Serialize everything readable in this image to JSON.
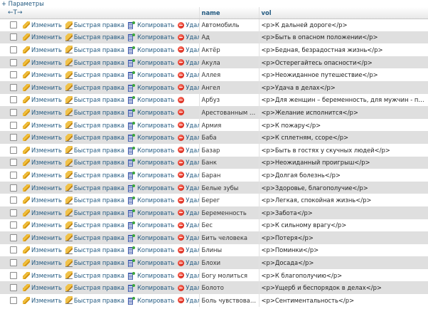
{
  "options_link": "+ Параметры",
  "header": {
    "arrows": "←T→",
    "col_name": "name",
    "col_vol": "vol"
  },
  "actions": {
    "edit": "Изменить",
    "quick_edit": "Быстрая правка",
    "copy": "Копировать",
    "delete": "Удалить"
  },
  "rows": [
    {
      "name": "Автомобиль",
      "vol": "<p>К дальней дороге</p>",
      "delete_label": "Удалить"
    },
    {
      "name": "Ад",
      "vol": "<p>Быть в опасном положении</p>",
      "delete_label": "Удалить"
    },
    {
      "name": "Актёр",
      "vol": "<p>Бедная, безрадостная жизнь</p>",
      "delete_label": "Удалить"
    },
    {
      "name": "Акула",
      "vol": "<p>Остерегайтесь опасности</p>",
      "delete_label": "Удалить"
    },
    {
      "name": "Аллея",
      "vol": "<p>Неожиданное путешествие</p>",
      "delete_label": "Удалить"
    },
    {
      "name": "Ангел",
      "vol": "<p>Удача в делах</p>",
      "delete_label": "Удалить"
    },
    {
      "name": "Арбуз",
      "vol": "<p>Для женщин – беременность, для мужчин - печаль,...",
      "delete_label": ""
    },
    {
      "name": "Арестованным быть",
      "vol": "<p>Желание исполнится</p>",
      "delete_label": ""
    },
    {
      "name": "Армия",
      "vol": "<p>К пожару</p>",
      "delete_label": "Удалить"
    },
    {
      "name": "Баба",
      "vol": "<p>К сплетням, ссоре</p>",
      "delete_label": "Удалить"
    },
    {
      "name": "Базар",
      "vol": "<p>Быть в гостях у скучных людей</p>",
      "delete_label": "Удалить"
    },
    {
      "name": "Банк",
      "vol": "<p>Неожиданный проигрыш</p>",
      "delete_label": "Удалить"
    },
    {
      "name": "Баран",
      "vol": "<p>Долгая болезнь</p>",
      "delete_label": "Удалить"
    },
    {
      "name": "Белые зубы",
      "vol": "<p>Здоровье, благополучие</p>",
      "delete_label": "Удалить"
    },
    {
      "name": "Берег",
      "vol": "<p>Легкая, спокойная жизнь</p>",
      "delete_label": "Удалить"
    },
    {
      "name": "Беременность",
      "vol": "<p>Забота</p>",
      "delete_label": "Удалить"
    },
    {
      "name": "Бес",
      "vol": "<p>К сильному врагу</p>",
      "delete_label": "Удалить"
    },
    {
      "name": "Бить человека",
      "vol": "<p>Потеря</p>",
      "delete_label": "Удалить"
    },
    {
      "name": "Блины",
      "vol": "<p>Поминки</p>",
      "delete_label": "Удалить"
    },
    {
      "name": "Блохи",
      "vol": "<p>Досада</p>",
      "delete_label": "Удалить"
    },
    {
      "name": "Богу молиться",
      "vol": "<p>К благополучию</p>",
      "delete_label": "Удалить"
    },
    {
      "name": "Болото",
      "vol": "<p>Ущерб и беспорядок в делах</p>",
      "delete_label": "Удалить"
    },
    {
      "name": "Боль чувствовать",
      "vol": "<p>Сентиментальность</p>",
      "delete_label": "Удалить"
    }
  ]
}
